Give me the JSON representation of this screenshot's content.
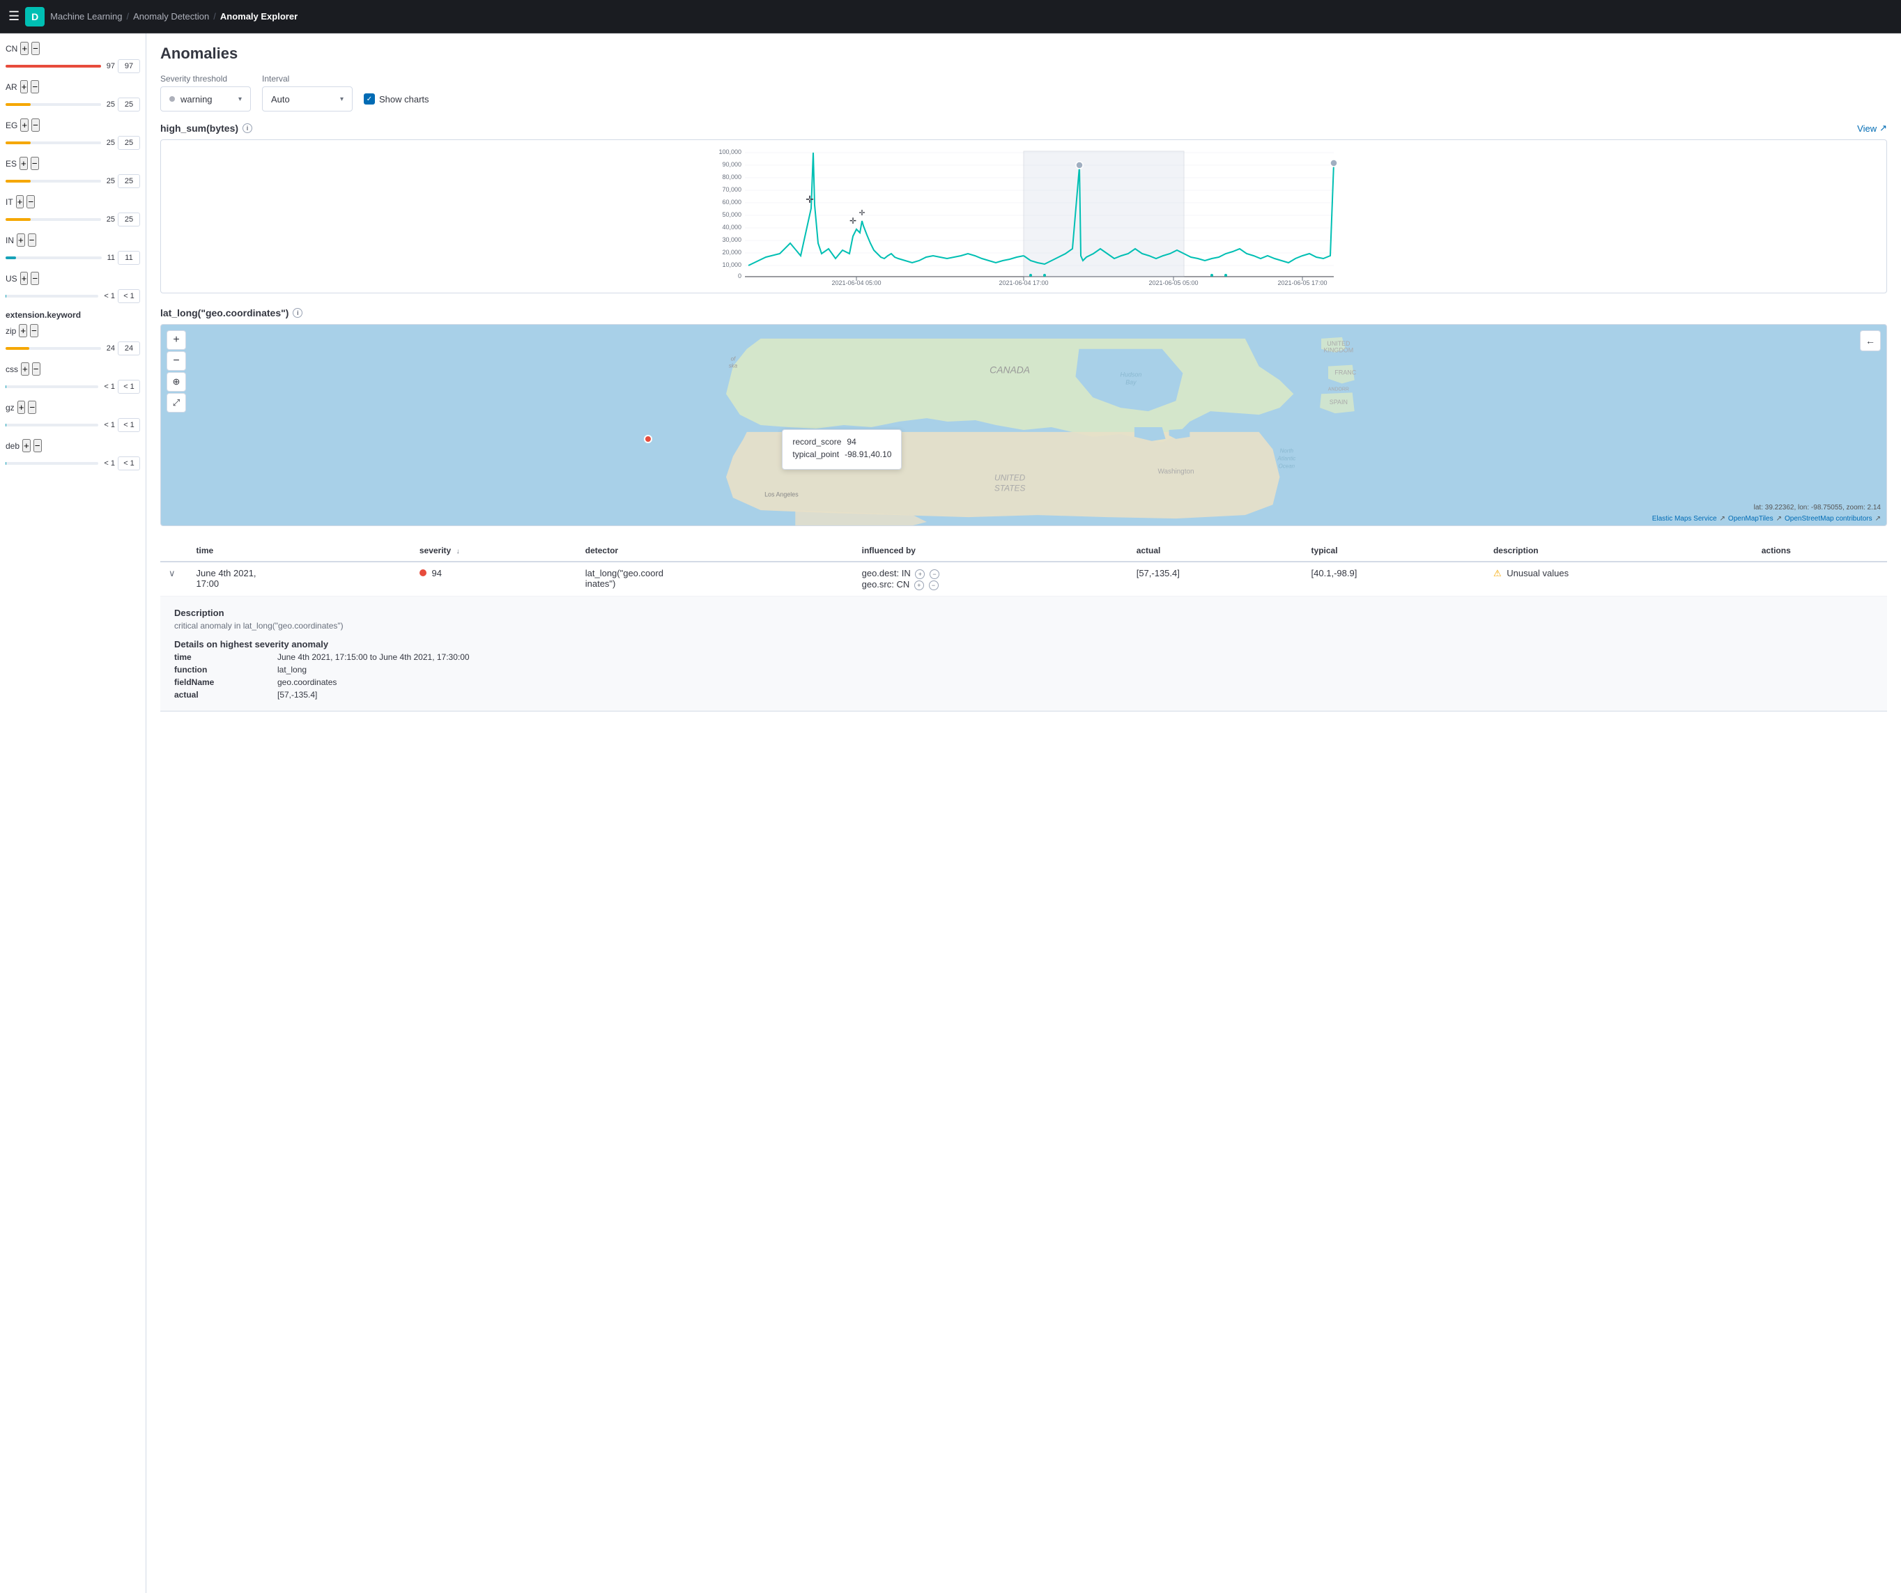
{
  "header": {
    "app_letter": "D",
    "breadcrumbs": [
      {
        "label": "Machine Learning",
        "href": "#"
      },
      {
        "label": "Anomaly Detection",
        "href": "#"
      },
      {
        "label": "Anomaly Explorer",
        "current": true
      }
    ]
  },
  "sidebar": {
    "section1_label": "CN",
    "items": [
      {
        "code": "CN",
        "color": "#e74c3c",
        "bar_pct": 100,
        "value": "97",
        "box": "97"
      },
      {
        "code": "AR",
        "color": "#f5a700",
        "bar_pct": 26,
        "value": "25",
        "box": "25"
      },
      {
        "code": "EG",
        "color": "#f5a700",
        "bar_pct": 26,
        "value": "25",
        "box": "25"
      },
      {
        "code": "ES",
        "color": "#f5a700",
        "bar_pct": 26,
        "value": "25",
        "box": "25"
      },
      {
        "code": "IT",
        "color": "#f5a700",
        "bar_pct": 26,
        "value": "25",
        "box": "25"
      },
      {
        "code": "IN",
        "color": "#17a2b8",
        "bar_pct": 11,
        "value": "11",
        "box": "11"
      },
      {
        "code": "US",
        "color": "#17a2b8",
        "bar_pct": 1,
        "value": "< 1",
        "box": "< 1"
      }
    ],
    "section2_title": "extension.keyword",
    "items2": [
      {
        "code": "zip",
        "color": "#f5a700",
        "bar_pct": 25,
        "value": "24",
        "box": "24"
      },
      {
        "code": "css",
        "color": "#17a2b8",
        "bar_pct": 1,
        "value": "< 1",
        "box": "< 1"
      },
      {
        "code": "gz",
        "color": "#17a2b8",
        "bar_pct": 1,
        "value": "< 1",
        "box": "< 1"
      },
      {
        "code": "deb",
        "color": "#17a2b8",
        "bar_pct": 1,
        "value": "< 1",
        "box": "< 1"
      }
    ]
  },
  "content": {
    "title": "Anomalies",
    "severity_label": "Severity threshold",
    "severity_value": "warning",
    "interval_label": "Interval",
    "interval_value": "Auto",
    "show_charts_label": "Show charts",
    "chart1_title": "high_sum(bytes)",
    "view_label": "View",
    "chart2_title": "lat_long(\"geo.coordinates\")",
    "chart": {
      "y_labels": [
        "100,000",
        "90,000",
        "80,000",
        "70,000",
        "60,000",
        "50,000",
        "40,000",
        "30,000",
        "20,000",
        "10,000",
        "0"
      ],
      "x_labels": [
        "2021-06-04 05:00",
        "2021-06-04 17:00",
        "2021-06-05 05:00",
        "2021-06-05 17:00"
      ]
    },
    "map": {
      "tooltip": {
        "record_score_label": "record_score",
        "record_score_value": "94",
        "typical_point_label": "typical_point",
        "typical_point_value": "-98.91,40.10"
      },
      "coords_label": "lat: 39.22362, lon: -98.75055, zoom: 2.14",
      "attribution1": "Elastic Maps Service",
      "attribution2": "OpenMapTiles",
      "attribution3": "OpenStreetMap contributors"
    },
    "table": {
      "columns": [
        "time",
        "severity",
        "detector",
        "influenced by",
        "actual",
        "typical",
        "description",
        "actions"
      ],
      "rows": [
        {
          "time": "June 4th 2021, 17:00",
          "severity_score": "94",
          "severity_color": "#e74c3c",
          "detector": "lat_long(\"geo.coordinates\")",
          "influenced_by": "geo.dest: IN\ngeo.src: CN",
          "actual": "[57,-135.4]",
          "typical": "[40.1,-98.9]",
          "description": "Unusual values",
          "has_warning": true,
          "expanded": true
        }
      ]
    },
    "expanded": {
      "description_title": "Description",
      "description_text": "critical anomaly in lat_long(\"geo.coordinates\")",
      "details_title": "Details on highest severity anomaly",
      "fields": [
        {
          "key": "time",
          "val": "June 4th 2021, 17:15:00 to June 4th 2021, 17:30:00"
        },
        {
          "key": "function",
          "val": "lat_long"
        },
        {
          "key": "fieldName",
          "val": "geo.coordinates"
        },
        {
          "key": "actual",
          "val": "[57,-135.4]"
        }
      ]
    }
  }
}
